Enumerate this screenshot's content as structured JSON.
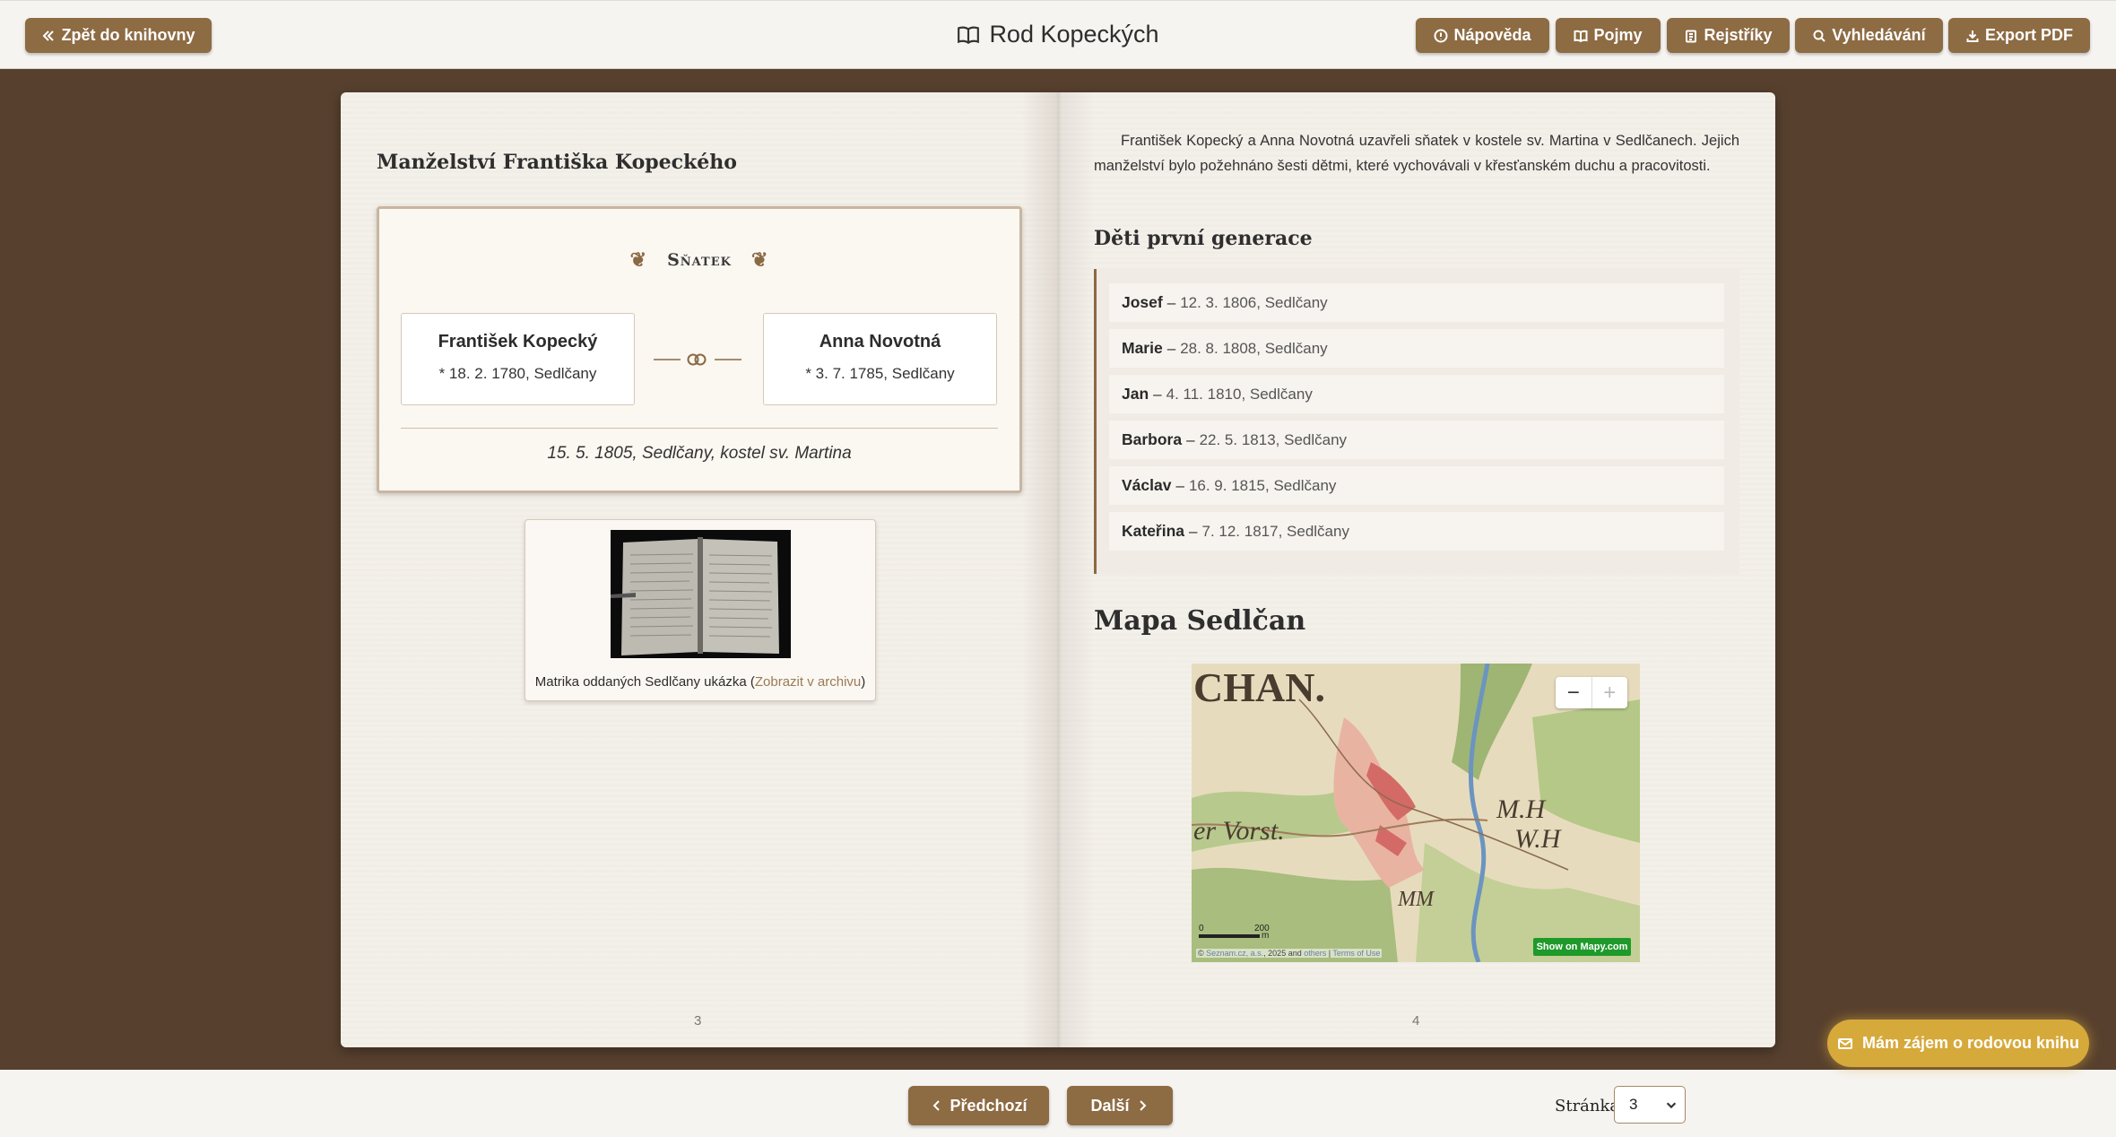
{
  "topbar": {
    "back_label": "Zpět do knihovny",
    "title": "Rod Kopeckých",
    "nav": {
      "help": "Nápověda",
      "terms": "Pojmy",
      "index": "Rejstříky",
      "search": "Vyhledávání",
      "export": "Export PDF"
    }
  },
  "left_page": {
    "heading": "Manželství Františka Kopeckého",
    "marriage": {
      "label": "Sňatek",
      "husband": {
        "name": "František Kopecký",
        "birth": "* 18. 2. 1780, Sedlčany"
      },
      "wife": {
        "name": "Anna Novotná",
        "birth": "* 3. 7. 1785, Sedlčany"
      },
      "details": "15. 5. 1805, Sedlčany, kostel sv. Martina"
    },
    "register": {
      "caption": "Matrika oddaných Sedlčany ukázka (",
      "link": "Zobrazit v archivu",
      "caption_end": ")"
    },
    "page_number": "3"
  },
  "right_page": {
    "intro": "František Kopecký a Anna Novotná uzavřeli sňatek v kostele sv. Martina v Sedlčanech. Jejich manželství bylo požehnáno šesti dětmi, které vychovávali v křesťanském duchu a pracovitosti.",
    "children_heading": "Děti první generace",
    "children": [
      {
        "name": "Josef",
        "info": "12. 3. 1806, Sedlčany"
      },
      {
        "name": "Marie",
        "info": "28. 8. 1808, Sedlčany"
      },
      {
        "name": "Jan",
        "info": "4. 11. 1810, Sedlčany"
      },
      {
        "name": "Barbora",
        "info": "22. 5. 1813, Sedlčany"
      },
      {
        "name": "Václav",
        "info": "16. 9. 1815, Sedlčany"
      },
      {
        "name": "Kateřina",
        "info": "7. 12. 1817, Sedlčany"
      }
    ],
    "map_heading": "Mapa Sedlčan",
    "map": {
      "zoom_out": "−",
      "zoom_in": "+",
      "scale_zero": "0",
      "scale_value": "200",
      "scale_unit": "m",
      "copyright_prefix": "© ",
      "copyright_link1": "Seznam.cz, a.s.",
      "copyright_mid": ", 2025 and ",
      "copyright_link2": "others",
      "copyright_sep": " | ",
      "copyright_link3": "Terms of Use",
      "show_on": "Show on Mapy.com"
    },
    "page_number": "4"
  },
  "bottombar": {
    "prev_label": "Předchozí",
    "next_label": "Další",
    "page_label": "Stránka",
    "page_value": "3"
  },
  "interest_label": "Mám zájem o rodovou knihu",
  "colors": {
    "accent": "#8d6b43",
    "background": "#57402e",
    "interest": "#d6a93b",
    "map_badge": "#1f9a2a"
  }
}
